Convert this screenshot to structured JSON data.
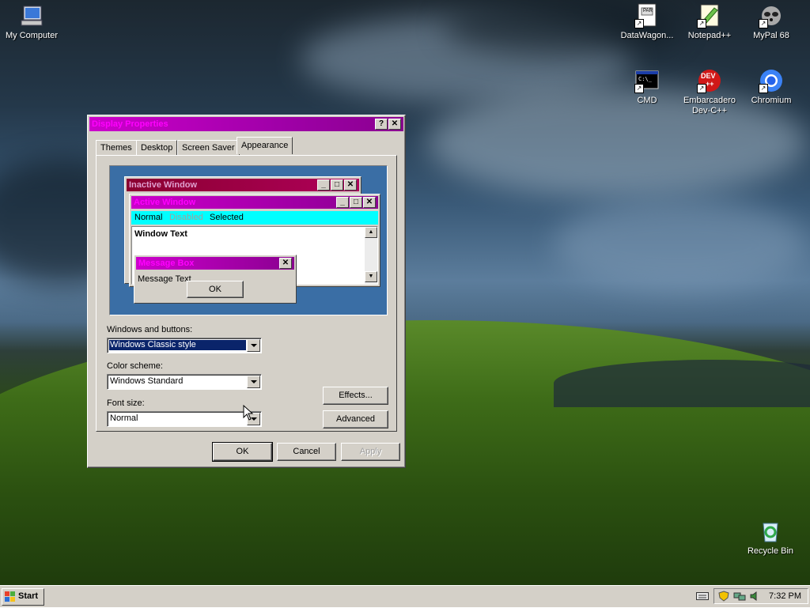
{
  "desktop": {
    "icons": {
      "my_computer": "My Computer",
      "datawagon": "DataWagon...",
      "notepadpp": "Notepad++",
      "mypal": "MyPal 68",
      "cmd": "CMD",
      "devcpp": "Embarcadero Dev-C++",
      "chromium": "Chromium",
      "recycle": "Recycle Bin"
    },
    "icon_glyphs": {
      "cmd_prompt": "C:\\_",
      "devcpp_badge": "DEV",
      "devcpp_plus": "++",
      "datawagon_badge": "PAR",
      "shortcut_arrow": "↗"
    }
  },
  "dialog": {
    "title": "Display Properties",
    "help_glyph": "?",
    "close_glyph": "✕",
    "tabs": [
      "Themes",
      "Desktop",
      "Screen Saver",
      "Appearance"
    ],
    "preview": {
      "inactive_title": "Inactive Window",
      "active_title": "Active Window",
      "menu_normal": "Normal",
      "menu_disabled": "Disabled",
      "menu_selected": "Selected",
      "window_text": "Window Text",
      "message_box_title": "Message Box",
      "message_text": "Message Text",
      "ok": "OK",
      "min_glyph": "_",
      "max_glyph": "□",
      "close_glyph": "✕",
      "scroll_up": "▲",
      "scroll_down": "▼"
    },
    "windows_buttons_label": "Windows and buttons:",
    "windows_buttons_value": "Windows Classic style",
    "color_scheme_label": "Color scheme:",
    "color_scheme_value": "Windows Standard",
    "font_size_label": "Font size:",
    "font_size_value": "Normal",
    "effects_button": "Effects...",
    "advanced_button": "Advanced",
    "ok_button": "OK",
    "cancel_button": "Cancel",
    "apply_button": "Apply"
  },
  "taskbar": {
    "start_label": "Start",
    "clock": "7:32 PM"
  },
  "colors": {
    "title_bar": "#a000a8",
    "title_text": "#ff00ff",
    "menu_bar": "#00ffff",
    "preview_desktop": "#3a6ea5",
    "selection": "#0a246a"
  }
}
